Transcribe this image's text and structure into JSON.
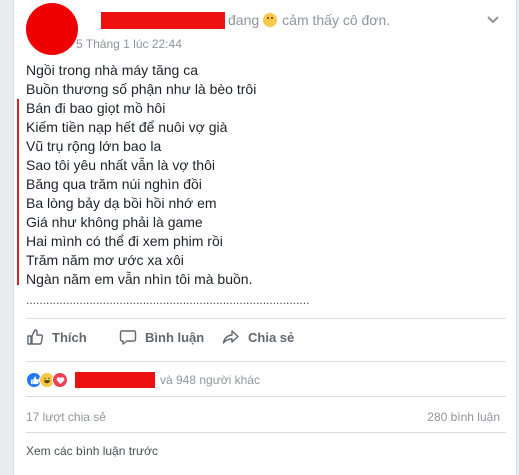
{
  "post": {
    "status_text": "đang",
    "feeling_text": "cảm thấy cô đơn.",
    "feeling_icon": "sad-face-icon",
    "timestamp": "5 Tháng 1 lúc 22:44",
    "poem_lines": [
      "Ngồi trong nhà máy tăng ca",
      "Buồn thương số phận như là bèo trôi",
      "Bán đi bao giọt mồ hôi",
      "Kiếm tiền nạp hết để nuôi vợ già",
      "Vũ trụ rộng lớn bao la",
      "Sao tôi yêu nhất vẫn là vợ thôi",
      "Băng qua trăm núi nghìn đồi",
      "Ba lòng bảy dạ bồi hồi nhớ em",
      "Giá như không phải là game",
      "Hai mình có thể đi xem phim rồi",
      "Trăm năm mơ ước xa xôi",
      "Ngàn năm em vẫn nhìn tôi mà buồn."
    ],
    "dotted_line": "....................................................................................."
  },
  "actions": {
    "like_label": "Thích",
    "comment_label": "Bình luận",
    "share_label": "Chia sẻ"
  },
  "reactions": {
    "others_text": "và 948 người khác",
    "icons": [
      "like-reaction-icon",
      "haha-reaction-icon",
      "love-reaction-icon"
    ]
  },
  "stats": {
    "shares": "17 lượt chia sẻ",
    "comments": "280 bình luận"
  },
  "comments": {
    "view_previous": "Xem các bình luận trước"
  },
  "colors": {
    "redaction": "#ee1111",
    "muted_text": "#90949c",
    "like_blue": "#2078f4",
    "love_red": "#f33e58",
    "haha_yellow": "#f7c948"
  }
}
